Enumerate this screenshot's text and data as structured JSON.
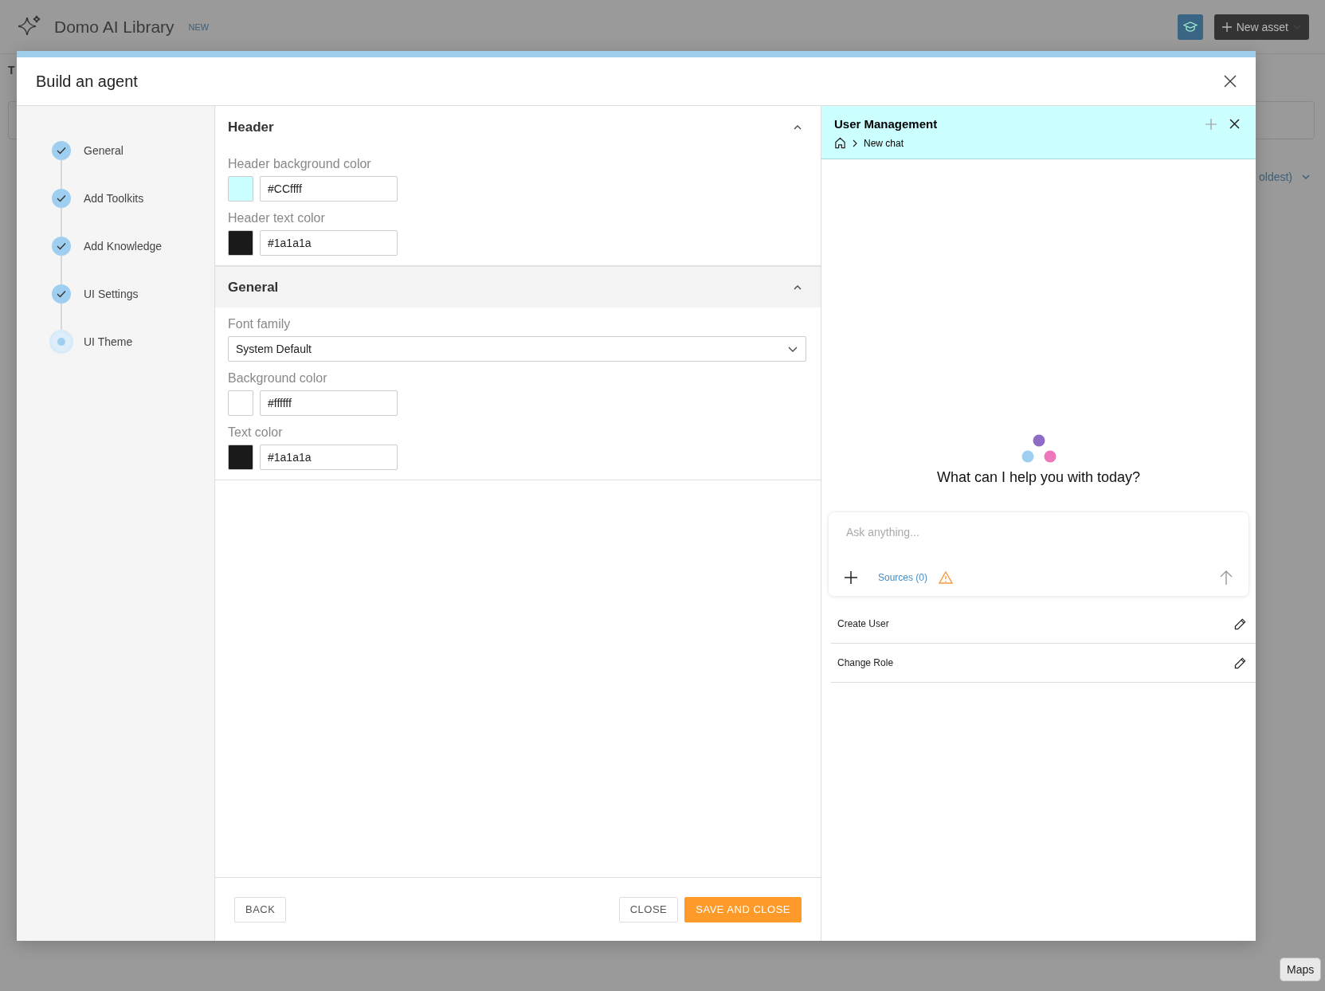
{
  "app_bar": {
    "title": "Domo AI Library",
    "badge": "NEW",
    "new_asset_button": "New asset"
  },
  "background": {
    "tab": "T",
    "sort_label": "oldest)"
  },
  "dialog": {
    "title": "Build an agent",
    "steps": [
      {
        "label": "General",
        "completed": true,
        "selected": false
      },
      {
        "label": "Add Toolkits",
        "completed": true,
        "selected": false
      },
      {
        "label": "Add Knowledge",
        "completed": true,
        "selected": false
      },
      {
        "label": "UI Settings",
        "completed": true,
        "selected": false
      },
      {
        "label": "UI Theme",
        "completed": false,
        "selected": true
      }
    ],
    "sections": [
      {
        "title": "Header",
        "expanded": true,
        "highlighted": false,
        "fields": [
          {
            "kind": "color",
            "label": "Header background color",
            "value": "#CCffff",
            "color": "#ccffff"
          },
          {
            "kind": "color",
            "label": "Header text color",
            "value": "#1a1a1a",
            "color": "#1a1a1a"
          }
        ]
      },
      {
        "title": "General",
        "expanded": true,
        "highlighted": true,
        "fields": [
          {
            "kind": "select",
            "label": "Font family",
            "value": "System Default"
          },
          {
            "kind": "color",
            "label": "Background color",
            "value": "#ffffff",
            "color": "#ffffff"
          },
          {
            "kind": "color",
            "label": "Text color",
            "value": "#1a1a1a",
            "color": "#1a1a1a"
          }
        ]
      }
    ],
    "buttons": {
      "back": "BACK",
      "close": "CLOSE",
      "save": "SAVE AND CLOSE"
    }
  },
  "preview": {
    "title": "User Management",
    "breadcrumb": "New chat",
    "greeting": "What can I help you with today?",
    "input": {
      "placeholder": "Ask anything..."
    },
    "sources": "Sources (0)",
    "prompts": [
      {
        "label": "Create User"
      },
      {
        "label": "Change Role"
      }
    ]
  },
  "tooltip": "Maps"
}
